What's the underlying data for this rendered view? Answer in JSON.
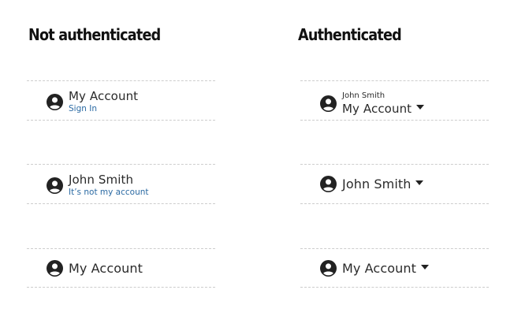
{
  "columns": {
    "left": {
      "heading": "Not authenticated",
      "rows": [
        {
          "title": "My Account",
          "link": "Sign In"
        },
        {
          "title": "John Smith",
          "link": "It’s not my account"
        },
        {
          "title": "My Account"
        }
      ]
    },
    "right": {
      "heading": "Authenticated",
      "rows": [
        {
          "username": "John Smith",
          "title": "My Account"
        },
        {
          "title": "John Smith"
        },
        {
          "title": "My Account"
        }
      ]
    }
  },
  "icons": {
    "avatar": "user-avatar-icon",
    "caret": "caret-down-icon"
  }
}
